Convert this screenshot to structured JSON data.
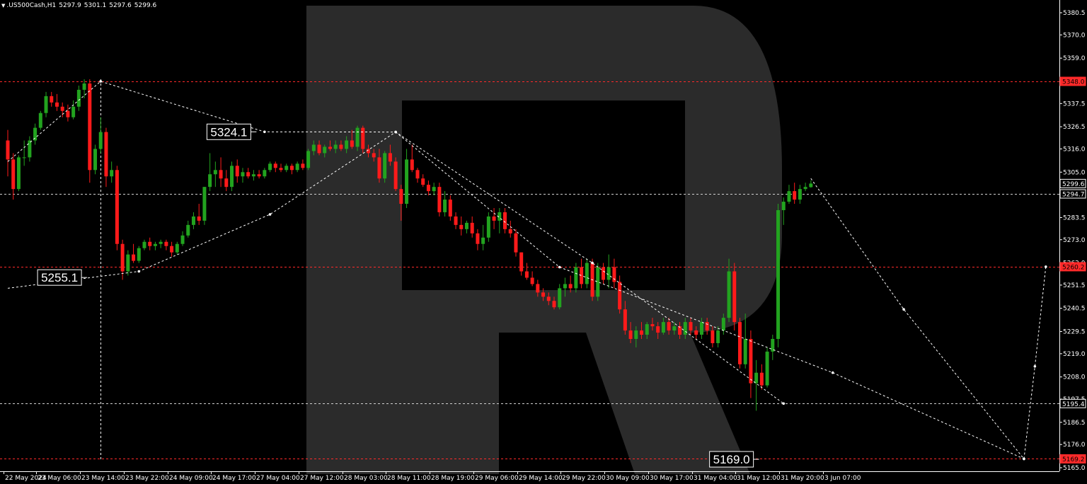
{
  "header": {
    "symbol": ".US500Cash,H1",
    "open": "5297.9",
    "high": "5301.1",
    "low": "5297.6",
    "close": "5299.6"
  },
  "colors": {
    "background": "#000000",
    "bull": "#22a31f",
    "bear": "#ff1a1a",
    "forecast": "#ffffff",
    "level": "#ff2a2a",
    "watermark": "#2b2b2b",
    "text": "#ffffff"
  },
  "watermark_icon": "large-r-logo-watermark",
  "chart_data": {
    "type": "candlestick",
    "y_ticks": [
      "5380.5",
      "5370.0",
      "5359.0",
      "5348.0",
      "5337.5",
      "5326.5",
      "5316.0",
      "5305.0",
      "5294.0",
      "5283.5",
      "5273.0",
      "5262.0",
      "5251.5",
      "5240.5",
      "5229.5",
      "5219.0",
      "5208.0",
      "5197.5",
      "5186.5",
      "5176.0",
      "5165.0"
    ],
    "x_ticks": [
      {
        "label": "22 May 2024",
        "i": 0
      },
      {
        "label": "23 May 06:00",
        "i": 6
      },
      {
        "label": "23 May 14:00",
        "i": 14
      },
      {
        "label": "23 May 22:00",
        "i": 22
      },
      {
        "label": "24 May 09:00",
        "i": 30
      },
      {
        "label": "24 May 17:00",
        "i": 38
      },
      {
        "label": "27 May 04:00",
        "i": 46
      },
      {
        "label": "27 May 12:00",
        "i": 54
      },
      {
        "label": "28 May 03:00",
        "i": 62
      },
      {
        "label": "28 May 11:00",
        "i": 70
      },
      {
        "label": "28 May 19:00",
        "i": 78
      },
      {
        "label": "29 May 06:00",
        "i": 86
      },
      {
        "label": "29 May 14:00",
        "i": 94
      },
      {
        "label": "29 May 22:00",
        "i": 102
      },
      {
        "label": "30 May 09:00",
        "i": 110
      },
      {
        "label": "30 May 17:00",
        "i": 118
      },
      {
        "label": "31 May 04:00",
        "i": 126
      },
      {
        "label": "31 May 12:00",
        "i": 134
      },
      {
        "label": "31 May 20:00",
        "i": 142
      },
      {
        "label": "3 Jun 07:00",
        "i": 150
      }
    ],
    "price_tags": [
      {
        "text": "5348.0",
        "value": 5348.0,
        "color": "#ff2a2a",
        "level": "red"
      },
      {
        "text": "5299.6",
        "value": 5299.6,
        "color": "#ffffff",
        "level": "none"
      },
      {
        "text": "5294.7",
        "value": 5294.7,
        "color": "#ffffff",
        "level": "white"
      },
      {
        "text": "5260.2",
        "value": 5260.2,
        "color": "#ff2a2a",
        "level": "red"
      },
      {
        "text": "5195.4",
        "value": 5195.4,
        "color": "#ffffff",
        "level": "white"
      },
      {
        "text": "5169.2",
        "value": 5169.2,
        "color": "#ff2a2a",
        "level": "red"
      }
    ],
    "annotations": [
      {
        "text": "5324.1",
        "i": 45,
        "value": 5324.1
      },
      {
        "text": "5255.1",
        "i": 14,
        "value": 5255.1
      },
      {
        "text": "5169.0",
        "i": 137,
        "value": 5169.0
      }
    ],
    "vertical_marker": {
      "i": 17
    },
    "forecast_lines": [
      [
        [
          0,
          5310
        ],
        [
          17,
          5348
        ],
        [
          47,
          5324.1
        ],
        [
          71,
          5324
        ],
        [
          107,
          5262
        ],
        [
          142,
          5195.4
        ]
      ],
      [
        [
          0,
          5250
        ],
        [
          24,
          5258
        ],
        [
          48,
          5285
        ],
        [
          71,
          5324
        ]
      ],
      [
        [
          71,
          5324
        ],
        [
          101,
          5260
        ],
        [
          151,
          5210
        ],
        [
          186,
          5169.2
        ]
      ],
      [
        [
          147,
          5302
        ],
        [
          164,
          5240
        ],
        [
          186,
          5169.2
        ],
        [
          188,
          5213
        ],
        [
          190,
          5260.2
        ]
      ]
    ],
    "candles": [
      {
        "o": 5320,
        "h": 5325,
        "l": 5303,
        "c": 5311
      },
      {
        "o": 5311,
        "h": 5314,
        "l": 5292,
        "c": 5297
      },
      {
        "o": 5297,
        "h": 5313,
        "l": 5296,
        "c": 5312
      },
      {
        "o": 5312,
        "h": 5320,
        "l": 5308,
        "c": 5312
      },
      {
        "o": 5312,
        "h": 5322,
        "l": 5310,
        "c": 5320
      },
      {
        "o": 5320,
        "h": 5328,
        "l": 5318,
        "c": 5326
      },
      {
        "o": 5326,
        "h": 5334,
        "l": 5325,
        "c": 5333
      },
      {
        "o": 5333,
        "h": 5343,
        "l": 5331,
        "c": 5341
      },
      {
        "o": 5341,
        "h": 5343,
        "l": 5336,
        "c": 5338
      },
      {
        "o": 5338,
        "h": 5342,
        "l": 5334,
        "c": 5336
      },
      {
        "o": 5336,
        "h": 5338,
        "l": 5331,
        "c": 5334
      },
      {
        "o": 5334,
        "h": 5337,
        "l": 5329,
        "c": 5331
      },
      {
        "o": 5331,
        "h": 5339,
        "l": 5330,
        "c": 5336
      },
      {
        "o": 5336,
        "h": 5346,
        "l": 5334,
        "c": 5344
      },
      {
        "o": 5344,
        "h": 5349,
        "l": 5340,
        "c": 5347
      },
      {
        "o": 5347,
        "h": 5349,
        "l": 5300,
        "c": 5306
      },
      {
        "o": 5306,
        "h": 5318,
        "l": 5304,
        "c": 5316
      },
      {
        "o": 5316,
        "h": 5331,
        "l": 5314,
        "c": 5324
      },
      {
        "o": 5324,
        "h": 5326,
        "l": 5298,
        "c": 5303
      },
      {
        "o": 5303,
        "h": 5310,
        "l": 5300,
        "c": 5306
      },
      {
        "o": 5306,
        "h": 5308,
        "l": 5268,
        "c": 5271
      },
      {
        "o": 5271,
        "h": 5273,
        "l": 5254,
        "c": 5258
      },
      {
        "o": 5258,
        "h": 5268,
        "l": 5256,
        "c": 5266
      },
      {
        "o": 5266,
        "h": 5271,
        "l": 5262,
        "c": 5263
      },
      {
        "o": 5263,
        "h": 5270,
        "l": 5262,
        "c": 5269
      },
      {
        "o": 5269,
        "h": 5273,
        "l": 5268,
        "c": 5272
      },
      {
        "o": 5272,
        "h": 5274,
        "l": 5268,
        "c": 5270
      },
      {
        "o": 5270,
        "h": 5272,
        "l": 5268,
        "c": 5271
      },
      {
        "o": 5271,
        "h": 5273,
        "l": 5269,
        "c": 5272
      },
      {
        "o": 5272,
        "h": 5273,
        "l": 5268,
        "c": 5270
      },
      {
        "o": 5270,
        "h": 5272,
        "l": 5265,
        "c": 5267
      },
      {
        "o": 5267,
        "h": 5272,
        "l": 5266,
        "c": 5271
      },
      {
        "o": 5271,
        "h": 5277,
        "l": 5270,
        "c": 5275
      },
      {
        "o": 5275,
        "h": 5282,
        "l": 5274,
        "c": 5280
      },
      {
        "o": 5280,
        "h": 5286,
        "l": 5278,
        "c": 5284
      },
      {
        "o": 5284,
        "h": 5290,
        "l": 5280,
        "c": 5282
      },
      {
        "o": 5282,
        "h": 5298,
        "l": 5280,
        "c": 5298
      },
      {
        "o": 5298,
        "h": 5314,
        "l": 5296,
        "c": 5304
      },
      {
        "o": 5304,
        "h": 5310,
        "l": 5298,
        "c": 5306
      },
      {
        "o": 5306,
        "h": 5312,
        "l": 5298,
        "c": 5302
      },
      {
        "o": 5302,
        "h": 5306,
        "l": 5296,
        "c": 5298
      },
      {
        "o": 5298,
        "h": 5310,
        "l": 5296,
        "c": 5308
      },
      {
        "o": 5308,
        "h": 5311,
        "l": 5300,
        "c": 5303
      },
      {
        "o": 5303,
        "h": 5307,
        "l": 5300,
        "c": 5305
      },
      {
        "o": 5305,
        "h": 5307,
        "l": 5302,
        "c": 5303
      },
      {
        "o": 5303,
        "h": 5306,
        "l": 5301,
        "c": 5304
      },
      {
        "o": 5304,
        "h": 5306,
        "l": 5302,
        "c": 5303
      },
      {
        "o": 5303,
        "h": 5307,
        "l": 5302,
        "c": 5306
      },
      {
        "o": 5306,
        "h": 5310,
        "l": 5305,
        "c": 5309
      },
      {
        "o": 5309,
        "h": 5310,
        "l": 5305,
        "c": 5307
      },
      {
        "o": 5307,
        "h": 5309,
        "l": 5305,
        "c": 5306
      },
      {
        "o": 5306,
        "h": 5309,
        "l": 5305,
        "c": 5308
      },
      {
        "o": 5308,
        "h": 5309,
        "l": 5304,
        "c": 5306
      },
      {
        "o": 5306,
        "h": 5310,
        "l": 5305,
        "c": 5309
      },
      {
        "o": 5309,
        "h": 5311,
        "l": 5306,
        "c": 5307
      },
      {
        "o": 5307,
        "h": 5316,
        "l": 5306,
        "c": 5315
      },
      {
        "o": 5315,
        "h": 5320,
        "l": 5313,
        "c": 5318
      },
      {
        "o": 5318,
        "h": 5320,
        "l": 5313,
        "c": 5314
      },
      {
        "o": 5314,
        "h": 5318,
        "l": 5312,
        "c": 5317
      },
      {
        "o": 5317,
        "h": 5320,
        "l": 5315,
        "c": 5316
      },
      {
        "o": 5316,
        "h": 5320,
        "l": 5314,
        "c": 5318
      },
      {
        "o": 5318,
        "h": 5320,
        "l": 5315,
        "c": 5316
      },
      {
        "o": 5316,
        "h": 5322,
        "l": 5314,
        "c": 5320
      },
      {
        "o": 5320,
        "h": 5325,
        "l": 5316,
        "c": 5317
      },
      {
        "o": 5317,
        "h": 5327,
        "l": 5315,
        "c": 5326
      },
      {
        "o": 5326,
        "h": 5327,
        "l": 5314,
        "c": 5316
      },
      {
        "o": 5316,
        "h": 5318,
        "l": 5312,
        "c": 5314
      },
      {
        "o": 5314,
        "h": 5316,
        "l": 5310,
        "c": 5312
      },
      {
        "o": 5312,
        "h": 5316,
        "l": 5300,
        "c": 5302
      },
      {
        "o": 5302,
        "h": 5315,
        "l": 5300,
        "c": 5314
      },
      {
        "o": 5314,
        "h": 5318,
        "l": 5308,
        "c": 5310
      },
      {
        "o": 5310,
        "h": 5312,
        "l": 5296,
        "c": 5297
      },
      {
        "o": 5297,
        "h": 5299,
        "l": 5282,
        "c": 5290
      },
      {
        "o": 5290,
        "h": 5316,
        "l": 5288,
        "c": 5311
      },
      {
        "o": 5311,
        "h": 5318,
        "l": 5305,
        "c": 5306
      },
      {
        "o": 5306,
        "h": 5307,
        "l": 5300,
        "c": 5302
      },
      {
        "o": 5302,
        "h": 5304,
        "l": 5298,
        "c": 5299
      },
      {
        "o": 5299,
        "h": 5301,
        "l": 5294,
        "c": 5296
      },
      {
        "o": 5296,
        "h": 5300,
        "l": 5294,
        "c": 5298
      },
      {
        "o": 5298,
        "h": 5300,
        "l": 5284,
        "c": 5286
      },
      {
        "o": 5286,
        "h": 5296,
        "l": 5284,
        "c": 5292
      },
      {
        "o": 5292,
        "h": 5294,
        "l": 5282,
        "c": 5284
      },
      {
        "o": 5284,
        "h": 5286,
        "l": 5278,
        "c": 5280
      },
      {
        "o": 5280,
        "h": 5284,
        "l": 5275,
        "c": 5278
      },
      {
        "o": 5278,
        "h": 5282,
        "l": 5276,
        "c": 5281
      },
      {
        "o": 5281,
        "h": 5284,
        "l": 5274,
        "c": 5276
      },
      {
        "o": 5276,
        "h": 5278,
        "l": 5268,
        "c": 5271
      },
      {
        "o": 5271,
        "h": 5280,
        "l": 5268,
        "c": 5274
      },
      {
        "o": 5274,
        "h": 5286,
        "l": 5272,
        "c": 5284
      },
      {
        "o": 5284,
        "h": 5288,
        "l": 5278,
        "c": 5282
      },
      {
        "o": 5282,
        "h": 5288,
        "l": 5276,
        "c": 5286
      },
      {
        "o": 5286,
        "h": 5288,
        "l": 5276,
        "c": 5278
      },
      {
        "o": 5278,
        "h": 5282,
        "l": 5274,
        "c": 5276
      },
      {
        "o": 5276,
        "h": 5278,
        "l": 5265,
        "c": 5267
      },
      {
        "o": 5267,
        "h": 5262,
        "l": 5256,
        "c": 5258
      },
      {
        "o": 5258,
        "h": 5262,
        "l": 5254,
        "c": 5255
      },
      {
        "o": 5255,
        "h": 5258,
        "l": 5251,
        "c": 5252
      },
      {
        "o": 5252,
        "h": 5254,
        "l": 5246,
        "c": 5248
      },
      {
        "o": 5248,
        "h": 5250,
        "l": 5244,
        "c": 5246
      },
      {
        "o": 5246,
        "h": 5248,
        "l": 5242,
        "c": 5244
      },
      {
        "o": 5244,
        "h": 5246,
        "l": 5240,
        "c": 5241
      },
      {
        "o": 5241,
        "h": 5252,
        "l": 5240,
        "c": 5250
      },
      {
        "o": 5250,
        "h": 5255,
        "l": 5246,
        "c": 5252
      },
      {
        "o": 5252,
        "h": 5256,
        "l": 5248,
        "c": 5250
      },
      {
        "o": 5250,
        "h": 5262,
        "l": 5248,
        "c": 5260
      },
      {
        "o": 5260,
        "h": 5264,
        "l": 5250,
        "c": 5252
      },
      {
        "o": 5252,
        "h": 5264,
        "l": 5250,
        "c": 5262
      },
      {
        "o": 5262,
        "h": 5264,
        "l": 5244,
        "c": 5246
      },
      {
        "o": 5246,
        "h": 5262,
        "l": 5244,
        "c": 5260
      },
      {
        "o": 5260,
        "h": 5262,
        "l": 5252,
        "c": 5254
      },
      {
        "o": 5254,
        "h": 5266,
        "l": 5250,
        "c": 5260
      },
      {
        "o": 5260,
        "h": 5264,
        "l": 5250,
        "c": 5253
      },
      {
        "o": 5253,
        "h": 5256,
        "l": 5238,
        "c": 5240
      },
      {
        "o": 5240,
        "h": 5244,
        "l": 5228,
        "c": 5230
      },
      {
        "o": 5230,
        "h": 5234,
        "l": 5224,
        "c": 5226
      },
      {
        "o": 5226,
        "h": 5232,
        "l": 5222,
        "c": 5230
      },
      {
        "o": 5230,
        "h": 5234,
        "l": 5226,
        "c": 5228
      },
      {
        "o": 5228,
        "h": 5234,
        "l": 5226,
        "c": 5233
      },
      {
        "o": 5233,
        "h": 5236,
        "l": 5230,
        "c": 5232
      },
      {
        "o": 5232,
        "h": 5234,
        "l": 5226,
        "c": 5229
      },
      {
        "o": 5229,
        "h": 5236,
        "l": 5228,
        "c": 5234
      },
      {
        "o": 5234,
        "h": 5236,
        "l": 5228,
        "c": 5230
      },
      {
        "o": 5230,
        "h": 5234,
        "l": 5228,
        "c": 5232
      },
      {
        "o": 5232,
        "h": 5234,
        "l": 5226,
        "c": 5228
      },
      {
        "o": 5228,
        "h": 5236,
        "l": 5226,
        "c": 5234
      },
      {
        "o": 5234,
        "h": 5236,
        "l": 5228,
        "c": 5230
      },
      {
        "o": 5230,
        "h": 5232,
        "l": 5226,
        "c": 5228
      },
      {
        "o": 5228,
        "h": 5236,
        "l": 5226,
        "c": 5234
      },
      {
        "o": 5234,
        "h": 5236,
        "l": 5228,
        "c": 5230
      },
      {
        "o": 5230,
        "h": 5232,
        "l": 5222,
        "c": 5224
      },
      {
        "o": 5224,
        "h": 5232,
        "l": 5222,
        "c": 5230
      },
      {
        "o": 5230,
        "h": 5238,
        "l": 5228,
        "c": 5236
      },
      {
        "o": 5236,
        "h": 5264,
        "l": 5234,
        "c": 5258
      },
      {
        "o": 5258,
        "h": 5262,
        "l": 5230,
        "c": 5234
      },
      {
        "o": 5234,
        "h": 5236,
        "l": 5212,
        "c": 5214
      },
      {
        "o": 5214,
        "h": 5238,
        "l": 5212,
        "c": 5226
      },
      {
        "o": 5226,
        "h": 5230,
        "l": 5198,
        "c": 5205
      },
      {
        "o": 5205,
        "h": 5216,
        "l": 5192,
        "c": 5210
      },
      {
        "o": 5210,
        "h": 5214,
        "l": 5202,
        "c": 5204
      },
      {
        "o": 5204,
        "h": 5222,
        "l": 5203,
        "c": 5220
      },
      {
        "o": 5220,
        "h": 5228,
        "l": 5216,
        "c": 5226
      },
      {
        "o": 5226,
        "h": 5290,
        "l": 5222,
        "c": 5287
      },
      {
        "o": 5287,
        "h": 5293,
        "l": 5280,
        "c": 5291
      },
      {
        "o": 5291,
        "h": 5299,
        "l": 5290,
        "c": 5296
      },
      {
        "o": 5296,
        "h": 5300,
        "l": 5290,
        "c": 5292
      },
      {
        "o": 5292,
        "h": 5299,
        "l": 5290,
        "c": 5297
      },
      {
        "o": 5297,
        "h": 5300,
        "l": 5296,
        "c": 5298
      },
      {
        "o": 5297.9,
        "h": 5301.1,
        "l": 5297.6,
        "c": 5299.6
      }
    ]
  }
}
